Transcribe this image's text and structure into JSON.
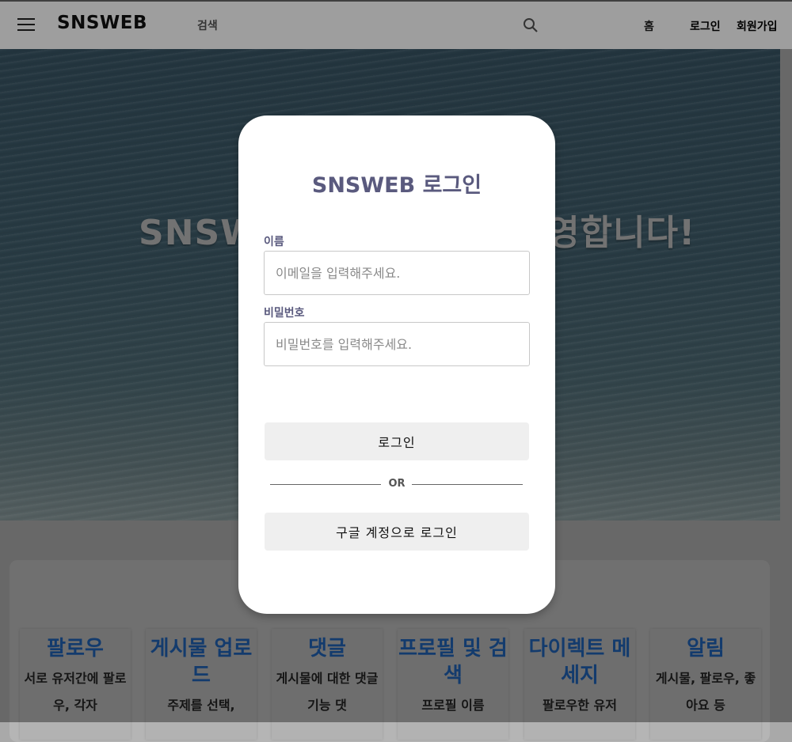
{
  "header": {
    "brand": "SNSWEB",
    "search_label": "검색",
    "nav": {
      "home": "홈",
      "login": "로그인",
      "signup": "회원가입"
    }
  },
  "hero": {
    "text": "SNSWEB에 오신 것을 환영합니다!"
  },
  "features": [
    {
      "title": "팔로우",
      "desc": "서로 유저간에 팔로우, 각자"
    },
    {
      "title": "게시물 업로드",
      "desc": "주제를 선택,"
    },
    {
      "title": "댓글",
      "desc": "게시물에 대한 댓글 기능 댓"
    },
    {
      "title": "프로필 및 검색",
      "desc": "프로필 이름"
    },
    {
      "title": "다이렉트 메세지",
      "desc": "팔로우한 유저"
    },
    {
      "title": "알림",
      "desc": "게시물, 팔로우, 좋아요 등"
    }
  ],
  "login_modal": {
    "title": "SNSWEB 로그인",
    "name_label": "이름",
    "name_placeholder": "이메일을 입력해주세요.",
    "password_label": "비밀번호",
    "password_placeholder": "비밀번호를 입력해주세요.",
    "login_button": "로그인",
    "or_text": "OR",
    "google_button": "구글 계정으로 로그인"
  }
}
